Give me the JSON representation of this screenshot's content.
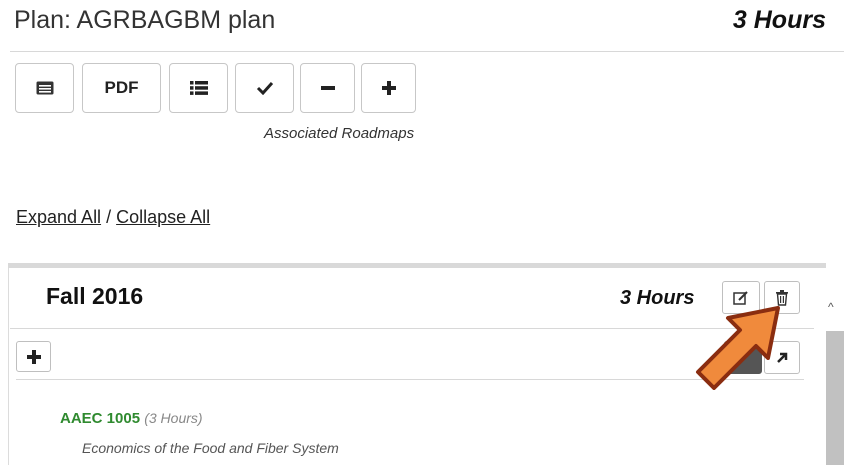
{
  "plan": {
    "title": "Plan: AGRBAGBM plan",
    "hours": "3 Hours"
  },
  "toolbar": {
    "buttons": [
      {
        "name": "details-button",
        "label": "",
        "icon": "card-icon"
      },
      {
        "name": "pdf-button",
        "label": "PDF",
        "icon": ""
      },
      {
        "name": "list-button",
        "label": "",
        "icon": "list-icon"
      },
      {
        "name": "check-button",
        "label": "",
        "icon": "check-icon"
      },
      {
        "name": "collapse-button",
        "label": "",
        "icon": "minus-icon"
      },
      {
        "name": "expand-button",
        "label": "",
        "icon": "plus-icon"
      }
    ],
    "associated_roadmaps": "Associated Roadmaps"
  },
  "links": {
    "expand_all": "Expand All",
    "separator": "/",
    "collapse_all": "Collapse All"
  },
  "term": {
    "title": "Fall 2016",
    "hours": "3 Hours",
    "edit_icon": "edit-icon",
    "delete_icon": "trash-icon",
    "add_icon": "plus-icon",
    "external_icon": "arrow-up-right-icon"
  },
  "course": {
    "code": "AAEC 1005",
    "hours": "(3 Hours)",
    "name": "Economics of the Food and Fiber System"
  },
  "colors": {
    "course_green": "#2f8a2f",
    "arrow_fill": "#f08a3c",
    "arrow_stroke": "#8a2d10"
  }
}
